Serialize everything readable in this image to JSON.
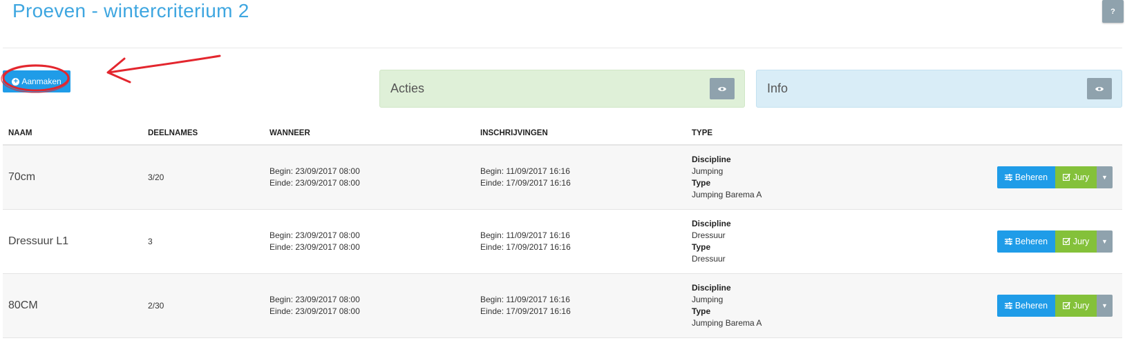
{
  "page": {
    "title": "Proeven - wintercriterium 2",
    "help_label": "?"
  },
  "toolbar": {
    "create_label": "Aanmaken"
  },
  "panels": {
    "acties": {
      "label": "Acties"
    },
    "info": {
      "label": "Info"
    }
  },
  "table": {
    "headers": [
      "NAAM",
      "DEELNAMES",
      "WANNEER",
      "INSCHRIJVINGEN",
      "TYPE"
    ],
    "rows": [
      {
        "naam": "70cm",
        "deelnames": "3/20",
        "wanneer_begin": "Begin: 23/09/2017 08:00",
        "wanneer_einde": "Einde: 23/09/2017 08:00",
        "inschrijving_begin": "Begin: 11/09/2017 16:16",
        "inschrijving_einde": "Einde: 17/09/2017 16:16",
        "discipline_label": "Discipline",
        "discipline": "Jumping",
        "type_label": "Type",
        "type": "Jumping Barema A"
      },
      {
        "naam": "Dressuur L1",
        "deelnames": "3",
        "wanneer_begin": "Begin: 23/09/2017 08:00",
        "wanneer_einde": "Einde: 23/09/2017 08:00",
        "inschrijving_begin": "Begin: 11/09/2017 16:16",
        "inschrijving_einde": "Einde: 17/09/2017 16:16",
        "discipline_label": "Discipline",
        "discipline": "Dressuur",
        "type_label": "Type",
        "type": "Dressuur"
      },
      {
        "naam": "80CM",
        "deelnames": "2/30",
        "wanneer_begin": "Begin: 23/09/2017 08:00",
        "wanneer_einde": "Einde: 23/09/2017 08:00",
        "inschrijving_begin": "Begin: 11/09/2017 16:16",
        "inschrijving_einde": "Einde: 17/09/2017 16:16",
        "discipline_label": "Discipline",
        "discipline": "Jumping",
        "type_label": "Type",
        "type": "Jumping Barema A"
      }
    ],
    "actions": {
      "beheren_label": "Beheren",
      "jury_label": "Jury"
    }
  },
  "colors": {
    "title": "#3ea6e0",
    "primary": "#1f9ce8",
    "success": "#84c13a",
    "muted": "#8fa2ad",
    "acties_bg": "#dff0d8",
    "info_bg": "#d9edf7",
    "annotation": "#e3262e"
  },
  "icons": {
    "help": "question-mark",
    "create": "plus-circle-icon",
    "panel_toggle": "eye-icon",
    "beheren": "sliders-icon",
    "jury": "check-square-icon",
    "dropdown": "caret-down-icon",
    "annotation": "red-arrow-and-circle"
  }
}
